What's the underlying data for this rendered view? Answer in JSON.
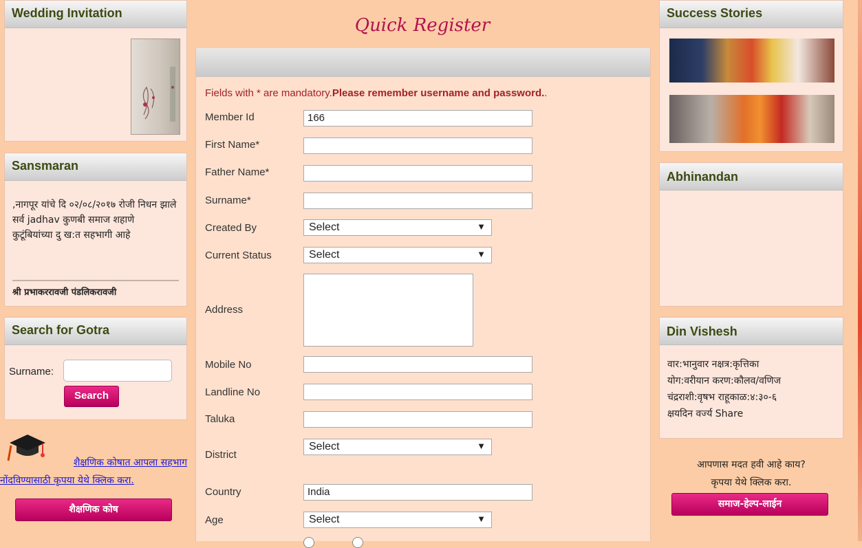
{
  "left": {
    "wedding": {
      "title": "Wedding Invitation"
    },
    "sansmaran": {
      "title": "Sansmaran",
      "text": ",नागपूर यांचे दि ०२/०८/२०१७ रोजी निधन झाले सर्व jadhav कुणबी समाज शहाणे कुटूंबियांच्या दु ख:त सहभागी आहे",
      "footer": "श्री प्रभाकररावजी पंडलिकरावजी"
    },
    "gotra": {
      "title": "Search for Gotra",
      "surname_label": "Surname:",
      "surname_value": "",
      "search_label": "Search"
    },
    "education": {
      "link_line1": "शैक्षणिक कोषात आपला सहभाग",
      "link_line2": "नोंदविण्यासाठी कृपया येथे क्लिक करा.",
      "button_label": "शैक्षणिक कोष"
    }
  },
  "center": {
    "title": "Quick Register",
    "notice_prefix": "Fields with * are mandatory.",
    "notice_bold": "Please remember username and password.",
    "notice_suffix": ".",
    "fields": {
      "member_id": {
        "label": "Member Id",
        "value": "166"
      },
      "first_name": {
        "label": "First Name*",
        "value": ""
      },
      "father_name": {
        "label": "Father Name*",
        "value": ""
      },
      "surname": {
        "label": "Surname*",
        "value": ""
      },
      "created_by": {
        "label": "Created By",
        "value": "Select"
      },
      "current_status": {
        "label": "Current Status",
        "value": "Select"
      },
      "address": {
        "label": "Address",
        "value": ""
      },
      "mobile": {
        "label": "Mobile No",
        "value": ""
      },
      "landline": {
        "label": "Landline No",
        "value": ""
      },
      "taluka": {
        "label": "Taluka",
        "value": ""
      },
      "district": {
        "label": "District",
        "value": "Select"
      },
      "country": {
        "label": "Country",
        "value": "India"
      },
      "age": {
        "label": "Age",
        "value": "Select"
      }
    }
  },
  "right": {
    "success": {
      "title": "Success Stories"
    },
    "abhinandan": {
      "title": "Abhinandan"
    },
    "din_vishesh": {
      "title": "Din Vishesh",
      "line1": "वार:भानुवार नक्षत्र:कृत्तिका",
      "line2": "योग:वरीयान करण:कौलव/वणिज",
      "line3": "चंद्रराशी:वृषभ राहूकाळ:४:३०-६",
      "line4": "क्षयदिन वर्ज्य Share"
    },
    "help": {
      "line1": "आपणास मदत हवी आहे काय?",
      "line2": "कृपया येथे क्लिक करा.",
      "button_label": "समाज-हेल्प-लाईन"
    }
  },
  "colors": {
    "page_bg": "#fccca6",
    "panel_bg": "#fde6dc",
    "title_pink": "#b0134f",
    "notice_red": "#a2222a",
    "button_pink": "#d10d70",
    "heading_olive": "#3c4a12"
  }
}
